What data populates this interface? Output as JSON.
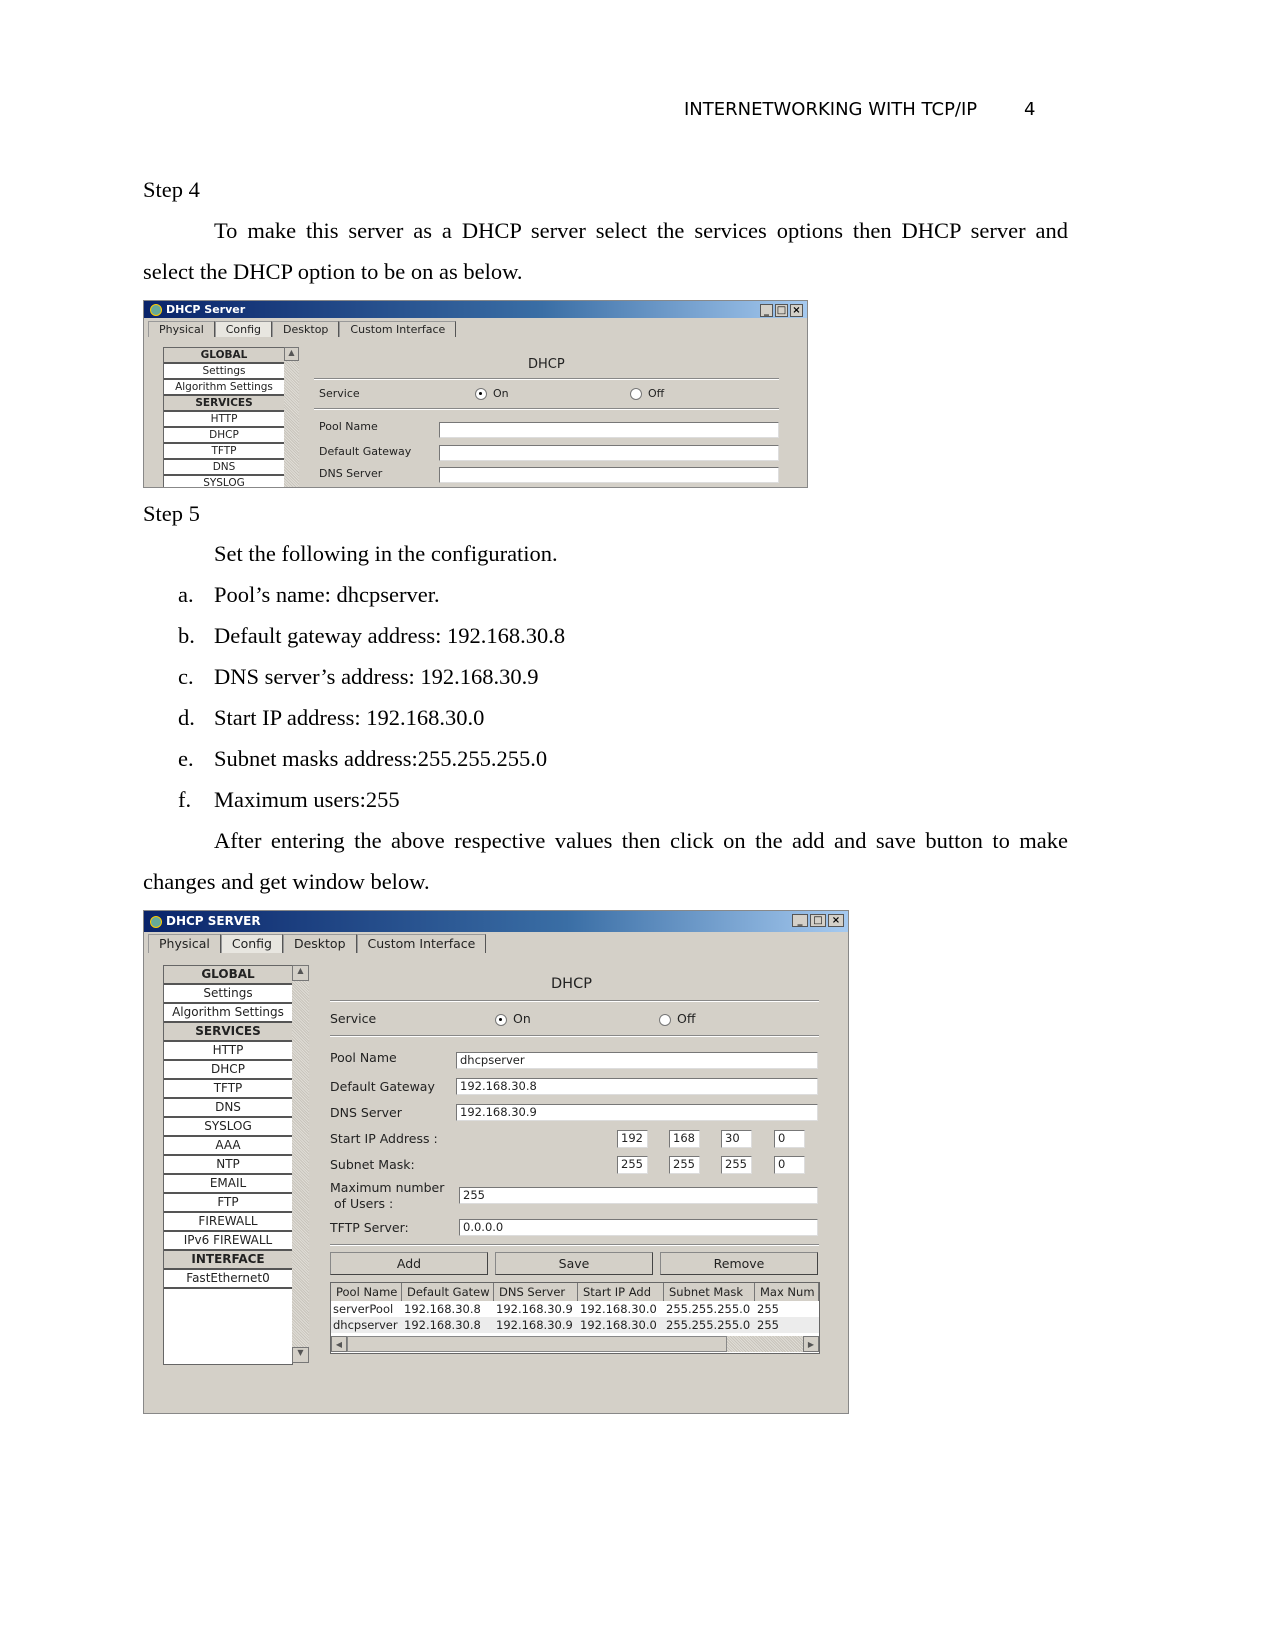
{
  "header": {
    "running_head": "INTERNETWORKING WITH TCP/IP",
    "page_number": "4"
  },
  "step4": {
    "heading": "Step 4",
    "para_line1": "To make this server as a DHCP server select the services options then DHCP server and",
    "para_line2": "select the DHCP option to be on as below."
  },
  "step5": {
    "heading": "Step 5",
    "intro": "Set the following in the configuration.",
    "items": [
      {
        "marker": "a.",
        "text": "Pool’s name: dhcpserver."
      },
      {
        "marker": "b.",
        "text": "Default gateway address: 192.168.30.8"
      },
      {
        "marker": "c.",
        "text": "DNS server’s address: 192.168.30.9"
      },
      {
        "marker": "d.",
        "text": "Start IP address: 192.168.30.0"
      },
      {
        "marker": "e.",
        "text": "Subnet masks address:255.255.255.0"
      },
      {
        "marker": "f.",
        "text": "Maximum users:255"
      }
    ],
    "para_line1": "After entering the above respective values then click on the add and save button to make",
    "para_line2": "changes and get window below."
  },
  "window1": {
    "title": "DHCP Server",
    "tabs": [
      "Physical",
      "Config",
      "Desktop",
      "Custom Interface"
    ],
    "active_tab": "Config",
    "sidebar": [
      "GLOBAL",
      "Settings",
      "Algorithm Settings",
      "SERVICES",
      "HTTP",
      "DHCP",
      "TFTP",
      "DNS",
      "SYSLOG"
    ],
    "panel_title": "DHCP",
    "service_label": "Service",
    "on_label": "On",
    "off_label": "Off",
    "service_state": "On",
    "pool_name_label": "Pool Name",
    "default_gateway_label": "Default Gateway",
    "dns_server_label": "DNS Server",
    "pool_name": "",
    "default_gateway": "",
    "dns_server": ""
  },
  "window2": {
    "title": "DHCP SERVER",
    "tabs": [
      "Physical",
      "Config",
      "Desktop",
      "Custom Interface"
    ],
    "active_tab": "Config",
    "sidebar": [
      "GLOBAL",
      "Settings",
      "Algorithm Settings",
      "SERVICES",
      "HTTP",
      "DHCP",
      "TFTP",
      "DNS",
      "SYSLOG",
      "AAA",
      "NTP",
      "EMAIL",
      "FTP",
      "FIREWALL",
      "IPv6 FIREWALL",
      "INTERFACE",
      "FastEthernet0"
    ],
    "panel_title": "DHCP",
    "service_label": "Service",
    "on_label": "On",
    "off_label": "Off",
    "service_state": "On",
    "pool_name_label": "Pool Name",
    "pool_name": "dhcpserver",
    "default_gateway_label": "Default Gateway",
    "default_gateway": "192.168.30.8",
    "dns_server_label": "DNS Server",
    "dns_server": "192.168.30.9",
    "start_ip_label": "Start IP Address :",
    "start_ip": [
      "192",
      "168",
      "30",
      "0"
    ],
    "subnet_label": "Subnet Mask:",
    "subnet": [
      "255",
      "255",
      "255",
      "0"
    ],
    "max_users_label_1": "Maximum number",
    "max_users_label_2": " of Users :",
    "max_users": "255",
    "tftp_label": "TFTP Server:",
    "tftp": "0.0.0.0",
    "buttons": {
      "add": "Add",
      "save": "Save",
      "remove": "Remove"
    },
    "table": {
      "columns": [
        "Pool Name",
        "Default Gatew",
        "DNS Server",
        "Start IP Add",
        "Subnet Mask",
        "Max Num"
      ],
      "rows": [
        [
          "serverPool",
          "192.168.30.8",
          "192.168.30.9",
          "192.168.30.0",
          "255.255.255.0",
          "255"
        ],
        [
          "dhcpserver",
          "192.168.30.8",
          "192.168.30.9",
          "192.168.30.0",
          "255.255.255.0",
          "255"
        ]
      ]
    }
  }
}
